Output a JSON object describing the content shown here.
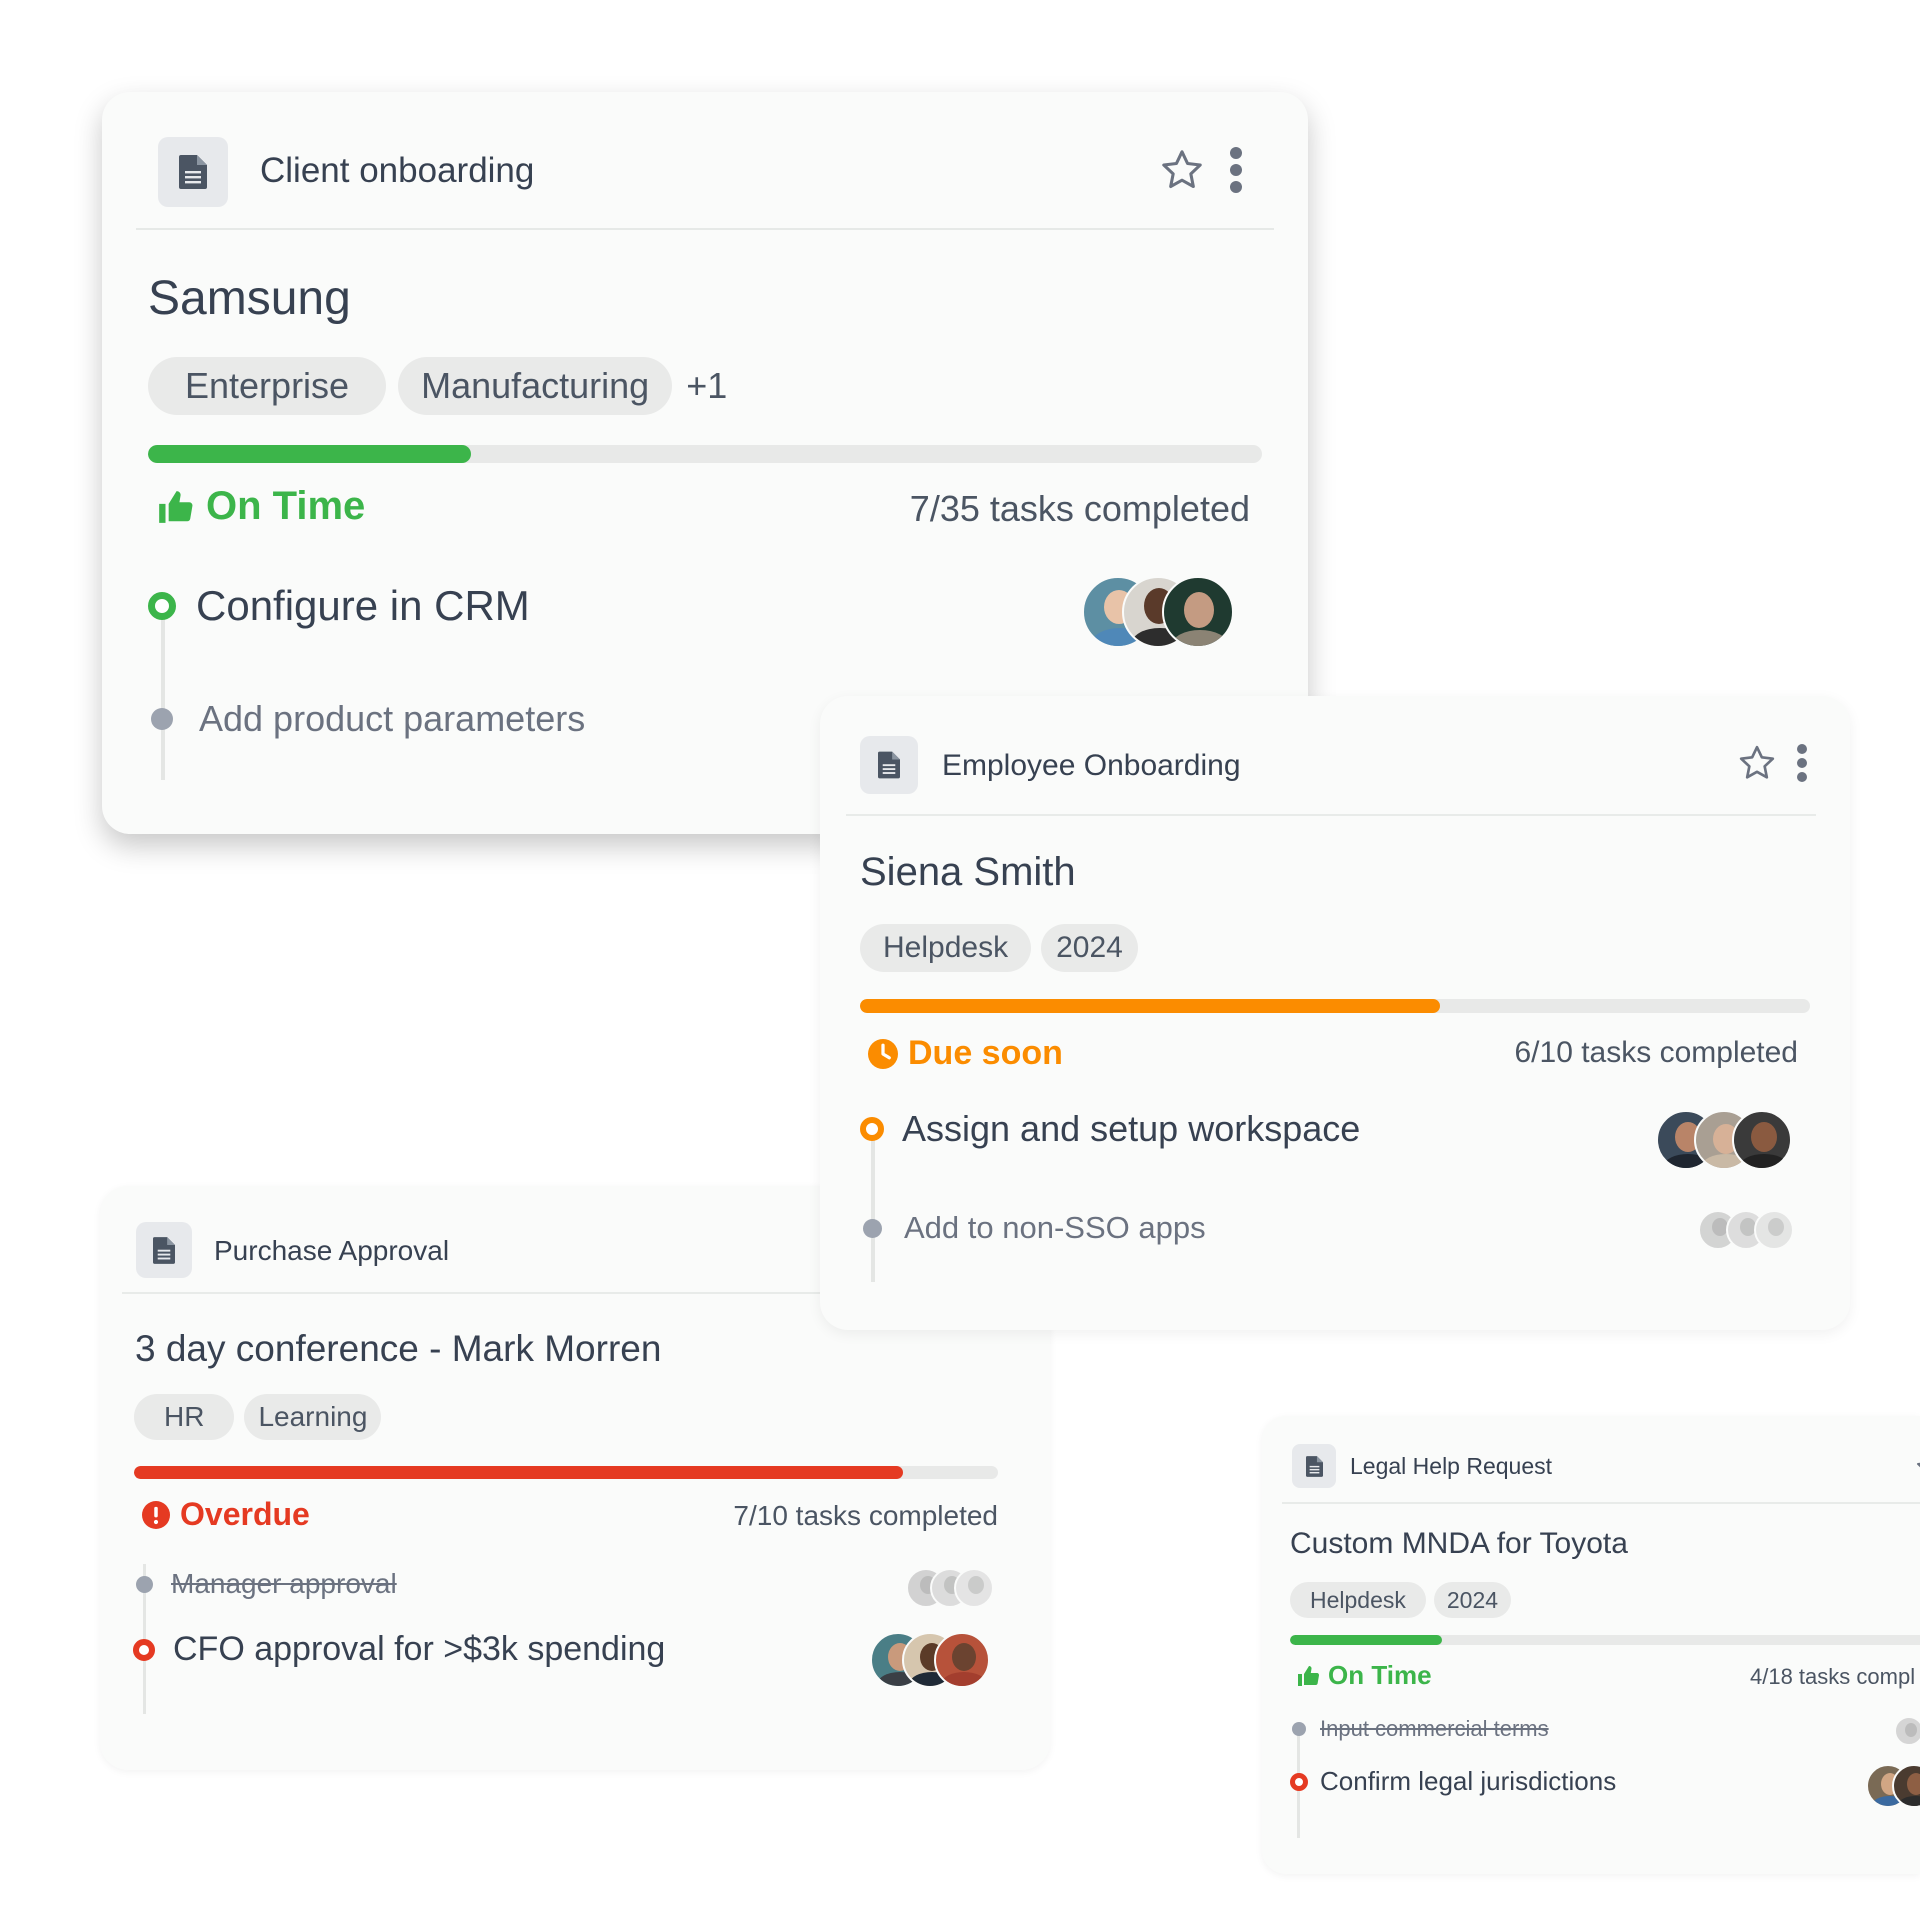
{
  "colors": {
    "green": "#3cb54a",
    "orange": "#fb8c00",
    "red": "#e53a22",
    "track": "#e8e9e8",
    "text": "#374151"
  },
  "cards": {
    "client": {
      "header_title": "Client onboarding",
      "title": "Samsung",
      "tags": [
        "Enterprise",
        "Manufacturing"
      ],
      "tags_more": "+1",
      "progress": 0.29,
      "status": "On Time",
      "tasks_completed": "7/35 tasks completed",
      "tasks": [
        {
          "label": "Configure in CRM",
          "state": "active"
        },
        {
          "label": "Add product parameters",
          "state": "pending"
        }
      ]
    },
    "employee": {
      "header_title": "Employee Onboarding",
      "title": "Siena Smith",
      "tags": [
        "Helpdesk",
        "2024"
      ],
      "progress": 0.61,
      "status": "Due soon",
      "tasks_completed": "6/10 tasks completed",
      "tasks": [
        {
          "label": "Assign and setup workspace",
          "state": "active"
        },
        {
          "label": "Add to non-SSO apps",
          "state": "pending"
        }
      ]
    },
    "purchase": {
      "header_title": "Purchase Approval",
      "title": "3 day conference - Mark Morren",
      "tags": [
        "HR",
        "Learning"
      ],
      "progress": 0.89,
      "status": "Overdue",
      "tasks_completed": "7/10 tasks completed",
      "tasks": [
        {
          "label": "Manager approval",
          "state": "done"
        },
        {
          "label": "CFO approval for >$3k spending",
          "state": "active"
        }
      ]
    },
    "legal": {
      "header_title": "Legal Help Request",
      "title": "Custom MNDA for Toyota",
      "tags": [
        "Helpdesk",
        "2024"
      ],
      "progress": 0.2,
      "status": "On Time",
      "tasks_completed": "4/18 tasks compl",
      "tasks": [
        {
          "label": "Input commercial terms",
          "state": "done"
        },
        {
          "label": "Confirm legal jurisdictions",
          "state": "active"
        }
      ]
    }
  },
  "icons": {
    "document": "document-icon",
    "star": "star-outline-icon",
    "more": "more-vertical-icon",
    "thumbs_up": "thumbs-up-icon",
    "clock": "clock-icon",
    "alert": "alert-circle-icon"
  }
}
